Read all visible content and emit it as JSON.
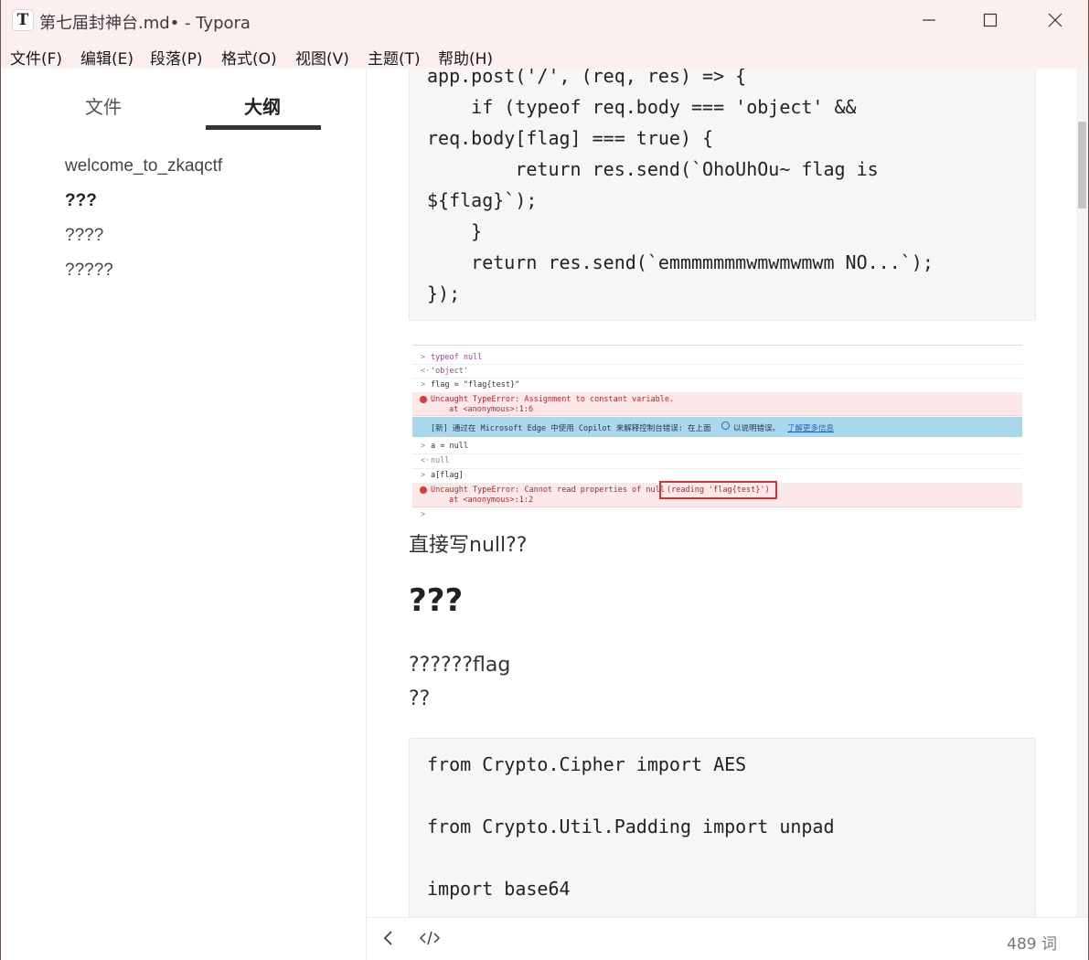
{
  "window": {
    "title": "第七届封神台.md• - Typora",
    "app_icon_letter": "T"
  },
  "menu": [
    "文件(F)",
    "编辑(E)",
    "段落(P)",
    "格式(O)",
    "视图(V)",
    "主题(T)",
    "帮助(H)"
  ],
  "sidebar": {
    "tabs": [
      "文件",
      "大纲"
    ],
    "active_tab": "大纲",
    "outline": [
      "welcome_to_zkaqctf",
      "???",
      "????",
      "?????"
    ]
  },
  "editor": {
    "code_block_1": [
      "app.post('/', (req, res) => {",
      "    if (typeof req.body === 'object' &&",
      "req.body[flag] === true) {",
      "        return res.send(`OhoUhOu~ flag is",
      "${flag}`);",
      "    }",
      "    return res.send(`emmmmmmmwmwmwmwm NO...`);",
      "});"
    ],
    "console_screenshot": {
      "lines": [
        "typeof null",
        "'object'",
        "flag = \"flag{test}\"",
        "Uncaught TypeError: Assignment to constant variable.",
        "at <anonymous>:1:6",
        "[新] 通过在 Microsoft Edge 中使用 Copilot 来解释控制台错误: 在上面",
        "以说明错误。",
        "了解更多信息",
        "a = null",
        "null",
        "a[flag]",
        "Uncaught TypeError: Cannot read properties of null",
        "(reading 'flag{test}')",
        "at <anonymous>:1:2"
      ]
    },
    "para_1": "直接写null??",
    "heading": "???",
    "para_2": "??????flag",
    "para_3": "??",
    "code_block_2": [
      "from Crypto.Cipher import AES",
      "",
      "from Crypto.Util.Padding import unpad",
      "",
      "import base64"
    ]
  },
  "footer": {
    "word_count": "489 词"
  },
  "colors": {
    "titlebar_bg": "#fbeff0",
    "code_bg": "#f6f6f6",
    "error_bg": "#fce8e8",
    "info_bg": "#a9d8ec",
    "highlight_box": "#d63333"
  }
}
